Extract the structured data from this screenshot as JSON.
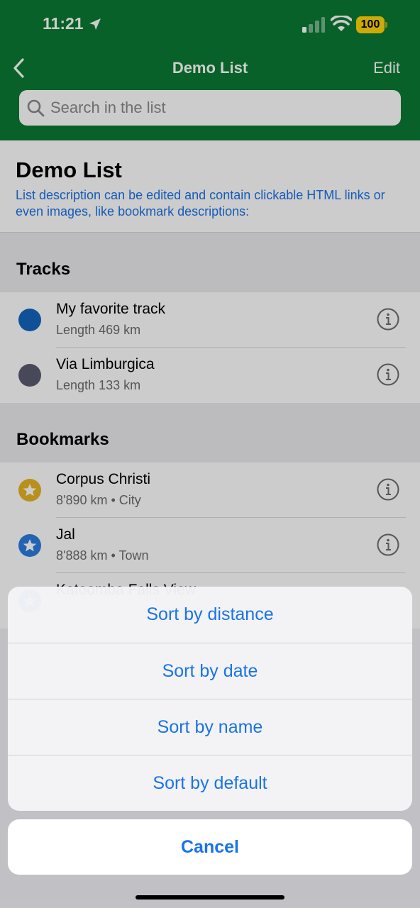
{
  "status_bar": {
    "time": "11:21",
    "battery": "100"
  },
  "nav": {
    "title": "Demo List",
    "edit_label": "Edit"
  },
  "search": {
    "placeholder": "Search in the list"
  },
  "list": {
    "title": "Demo List",
    "description": "List description can be edited and contain clickable HTML links or even images, like bookmark descriptions:"
  },
  "tracks": {
    "header": "Tracks",
    "items": [
      {
        "name": "My favorite track",
        "detail": "Length 469 km",
        "color": "#1565c0"
      },
      {
        "name": "Via Limburgica",
        "detail": "Length 133 km",
        "color": "#5a5a72"
      }
    ]
  },
  "bookmarks": {
    "header": "Bookmarks",
    "items": [
      {
        "name": "Corpus Christi",
        "detail": "8'890 km • City",
        "color": "#e6b422"
      },
      {
        "name": "Jal",
        "detail": "8'888 km • Town",
        "color": "#2b7de0"
      },
      {
        "name": "Katoomba Falls View",
        "detail": "",
        "color": "#2b7de0"
      }
    ]
  },
  "action_sheet": {
    "options": [
      "Sort by distance",
      "Sort by date",
      "Sort by name",
      "Sort by default"
    ],
    "cancel_label": "Cancel"
  },
  "colors": {
    "header_green": "#0b7a33",
    "accent_blue": "#1a73e8"
  }
}
